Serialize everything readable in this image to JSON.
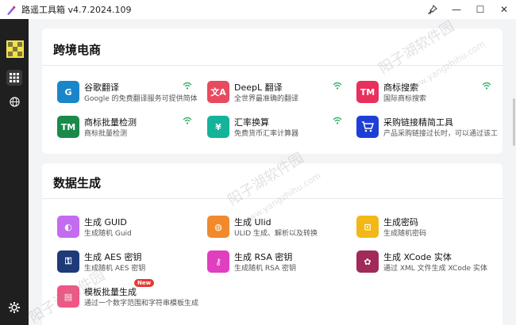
{
  "app": {
    "title": "路遥工具箱 v4.7.2024.109"
  },
  "window_controls": {
    "pin": "⚲",
    "minimize": "—",
    "maximize": "☐",
    "close": "✕"
  },
  "sections": [
    {
      "title": "跨境电商",
      "tools": [
        {
          "name": "谷歌翻译",
          "desc": "Google 的免费翻译服务可提供简体",
          "icon_text": "G",
          "color": "#1a86c9",
          "wifi": true
        },
        {
          "name": "DeepL 翻译",
          "desc": "全世界最准确的翻译",
          "icon_text": "文A",
          "color": "#e84a5f",
          "wifi": true
        },
        {
          "name": "商标搜索",
          "desc": "国际商标搜索",
          "icon_text": "TM",
          "color": "#e8305c",
          "wifi": true
        },
        {
          "name": "商标批量检测",
          "desc": "商标批量检测",
          "icon_text": "TM",
          "color": "#1a8a4a",
          "wifi": true
        },
        {
          "name": "汇率换算",
          "desc": "免费货币汇率计算器",
          "icon_text": "¥",
          "color": "#14b39a",
          "wifi": true
        },
        {
          "name": "采购链接精简工具",
          "desc": "产品采购链接过长时，可以通过该工",
          "icon_text": "🛒",
          "color": "#1e3fd6",
          "wifi": false
        }
      ]
    },
    {
      "title": "数据生成",
      "tools": [
        {
          "name": "生成 GUID",
          "desc": "生成随机 Guid",
          "icon_text": "◐",
          "color": "#c36cf0",
          "wifi": false
        },
        {
          "name": "生成 Ulid",
          "desc": "ULID 生成、解析以及转换",
          "icon_text": "◍",
          "color": "#f08a2c",
          "wifi": false
        },
        {
          "name": "生成密码",
          "desc": "生成随机密码",
          "icon_text": "⊡",
          "color": "#f2b817",
          "wifi": false
        },
        {
          "name": "生成 AES 密钥",
          "desc": "生成随机 AES 密钥",
          "icon_text": "⚿",
          "color": "#1f3a78",
          "wifi": false
        },
        {
          "name": "生成 RSA 密钥",
          "desc": "生成随机 RSA 密钥",
          "icon_text": "⚷",
          "color": "#e03fbf",
          "wifi": false
        },
        {
          "name": "生成 XCode 实体",
          "desc": "通过 XML 文件生成 XCode 实体",
          "icon_text": "✿",
          "color": "#a02a5a",
          "wifi": false
        },
        {
          "name": "模板批量生成",
          "desc": "通过一个数字范围和字符串模板生成",
          "icon_text": "▤",
          "color": "#f05585",
          "wifi": false,
          "badge": "New"
        }
      ]
    }
  ],
  "watermark": {
    "cn": "阳子湖软件园",
    "url": "www.yangzhihu.com"
  },
  "icons": {
    "sidebar": [
      "logo-icon",
      "grid-icon",
      "globe-icon",
      "settings-icon"
    ],
    "wifi": "wifi-icon"
  }
}
